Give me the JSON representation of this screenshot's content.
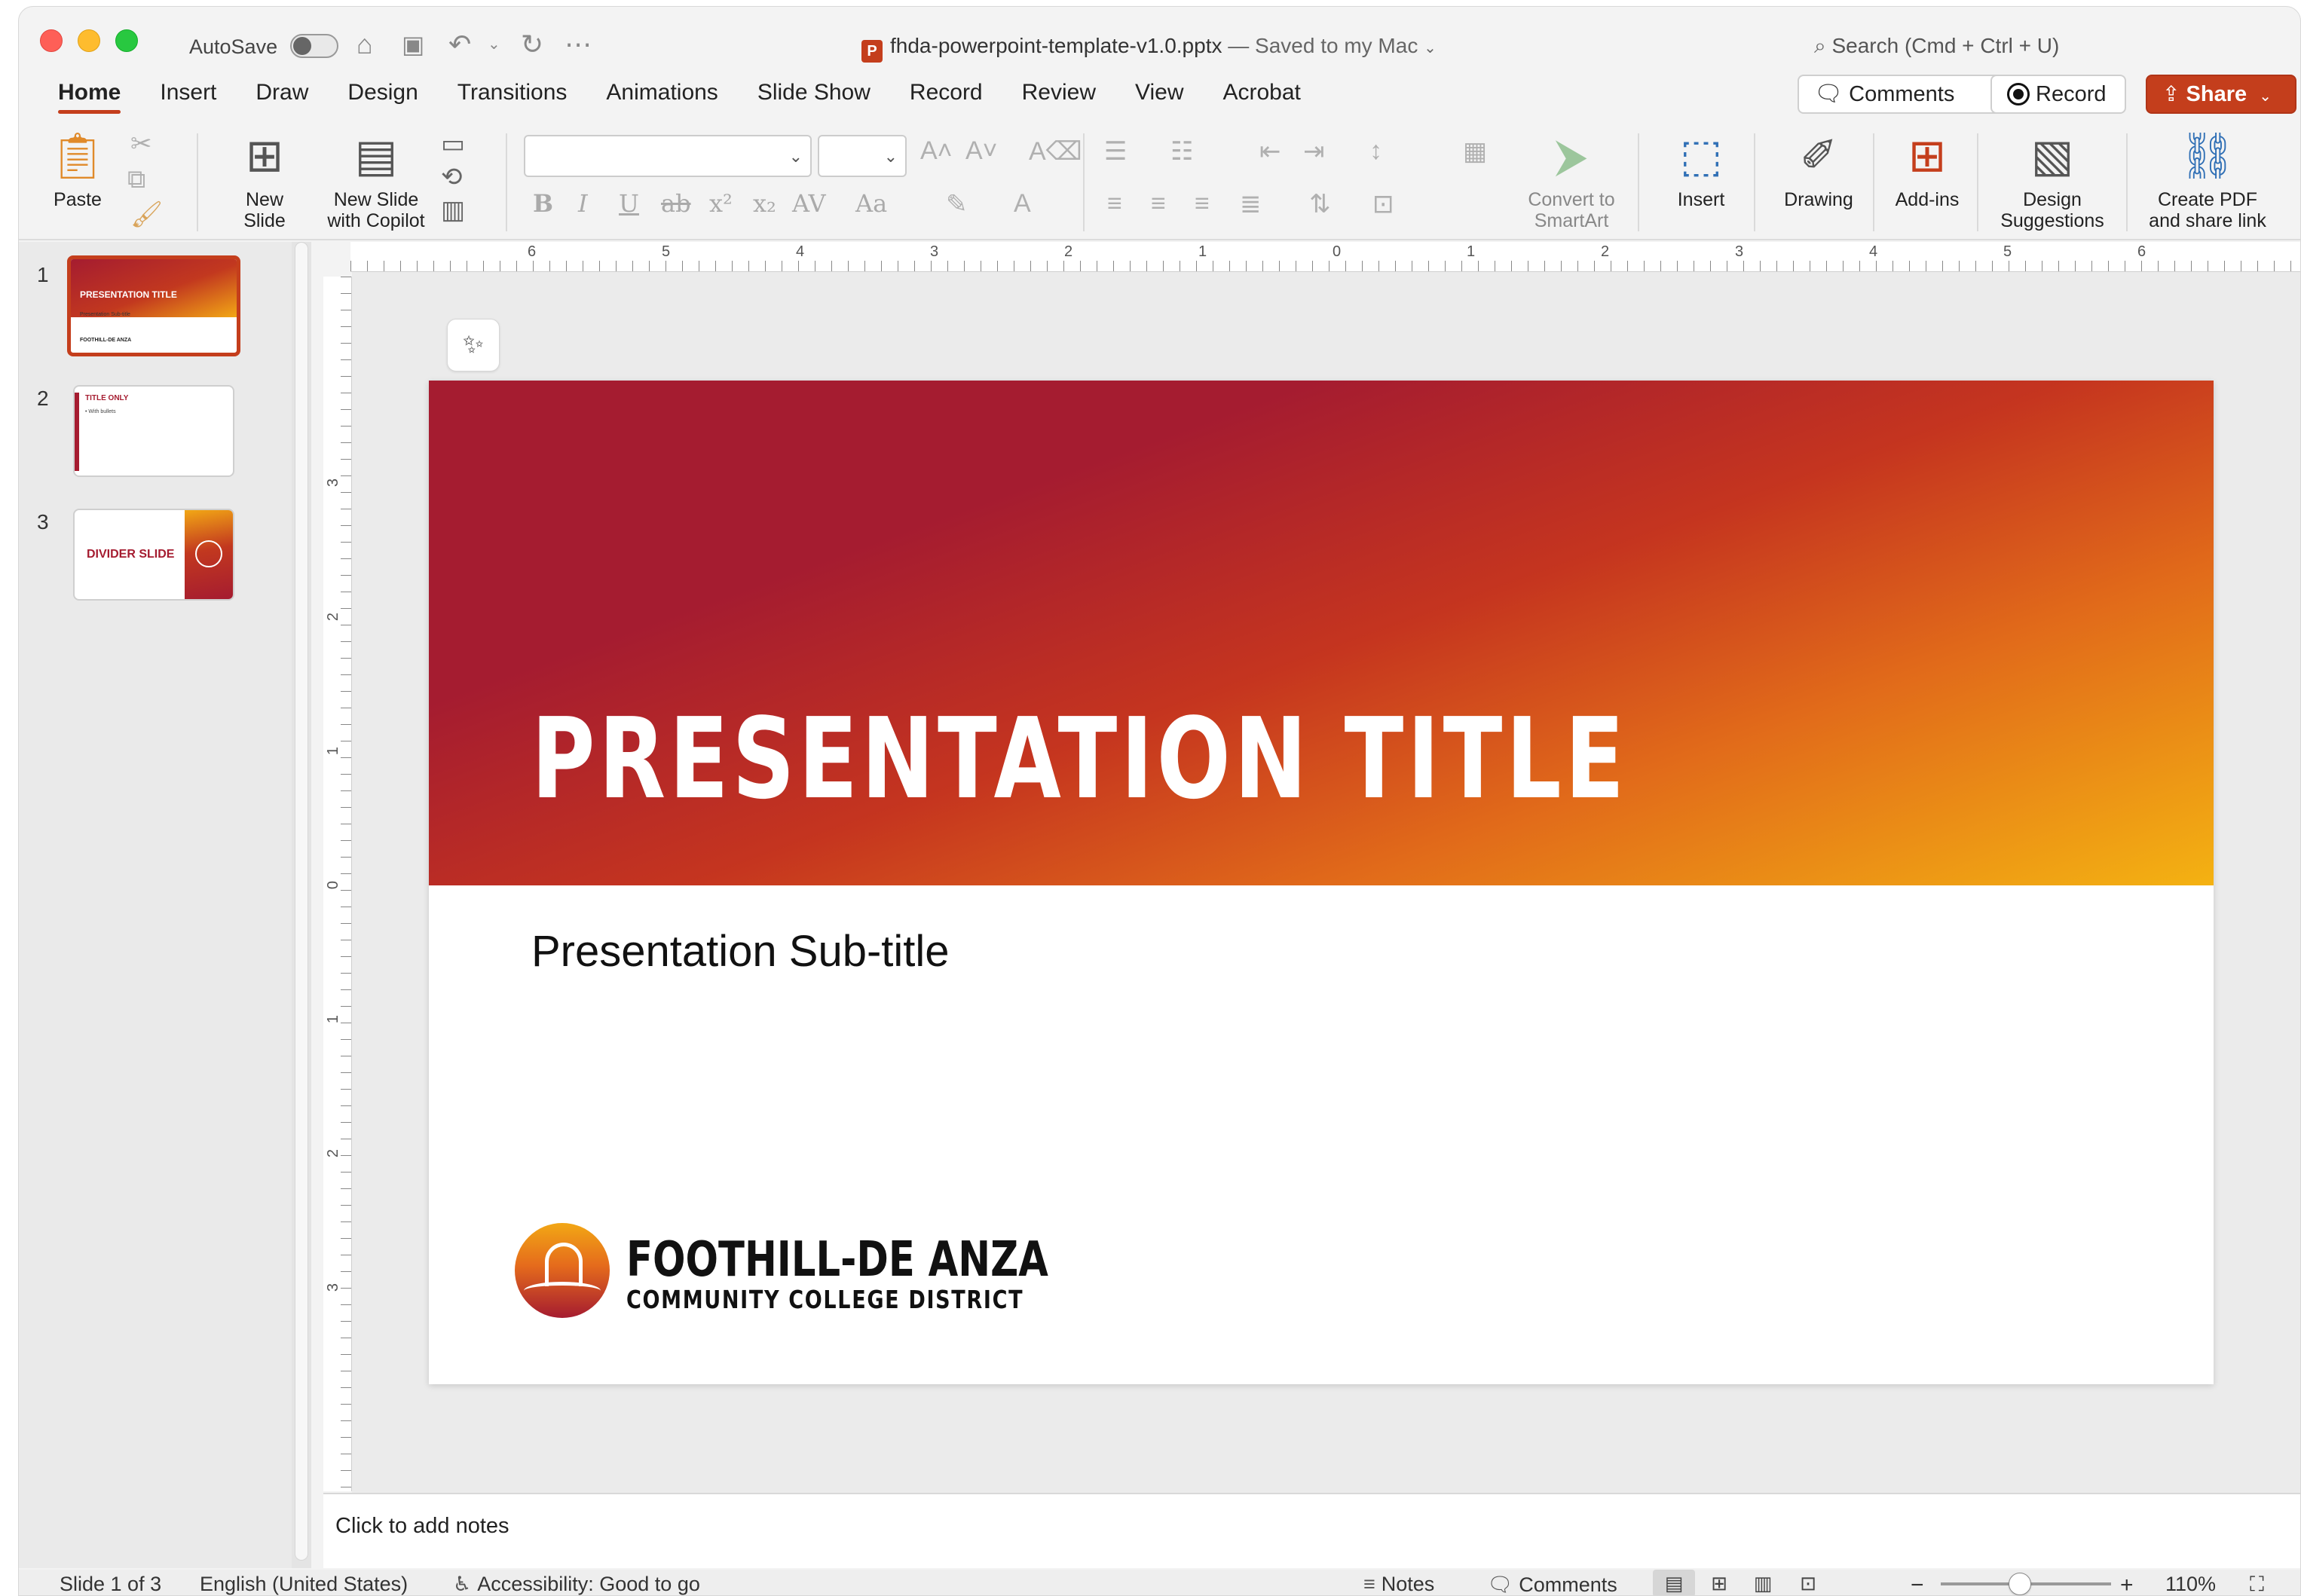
{
  "titlebar": {
    "autosave_label": "AutoSave",
    "filename": "fhda-powerpoint-template-v1.0.pptx",
    "save_status": "— Saved to my Mac",
    "app_badge": "P",
    "search_placeholder": "Search (Cmd + Ctrl + U)"
  },
  "tabs": [
    "Home",
    "Insert",
    "Draw",
    "Design",
    "Transitions",
    "Animations",
    "Slide Show",
    "Record",
    "Review",
    "View",
    "Acrobat"
  ],
  "actions": {
    "comments": "Comments",
    "record": "Record",
    "share": "Share"
  },
  "ribbon": {
    "paste": "Paste",
    "new_slide_line1": "New",
    "new_slide_line2": "Slide",
    "copilot_line1": "New Slide",
    "copilot_line2": "with Copilot",
    "smartart_line1": "Convert to",
    "smartart_line2": "SmartArt",
    "insert": "Insert",
    "drawing": "Drawing",
    "addins": "Add-ins",
    "design_sugg_line1": "Design",
    "design_sugg_line2": "Suggestions",
    "pdf_line1": "Create PDF",
    "pdf_line2": "and share link",
    "format": {
      "bold": "B",
      "italic": "I",
      "underline": "U",
      "strike": "ab",
      "super": "x²",
      "sub": "x₂",
      "spacing": "AV",
      "case": "Aa"
    }
  },
  "ruler": {
    "h_labels": [
      "6",
      "5",
      "4",
      "3",
      "2",
      "1",
      "0",
      "1",
      "2",
      "3",
      "4",
      "5",
      "6"
    ],
    "v_labels": [
      "3",
      "2",
      "1",
      "0",
      "1",
      "2",
      "3"
    ]
  },
  "thumbnails": [
    {
      "num": "1",
      "title": "PRESENTATION TITLE",
      "sub": "Presentation Sub-title",
      "logo": "FOOTHILL-DE ANZA"
    },
    {
      "num": "2",
      "title": "TITLE ONLY",
      "bullet": "• With bullets"
    },
    {
      "num": "3",
      "title": "DIVIDER SLIDE"
    }
  ],
  "slide": {
    "title": "PRESENTATION TITLE",
    "subtitle": "Presentation Sub-title",
    "logo_line1": "FOOTHILL-DE ANZA",
    "logo_line2": "COMMUNITY COLLEGE DISTRICT"
  },
  "notes_placeholder": "Click to add notes",
  "status": {
    "slide_position": "Slide 1 of 3",
    "language": "English (United States)",
    "accessibility": "Accessibility: Good to go",
    "notes": "Notes",
    "comments": "Comments",
    "zoom": "110%"
  },
  "colors": {
    "accent": "#c43e1c",
    "brand_red": "#a51c30",
    "brand_gold": "#f4b212"
  }
}
